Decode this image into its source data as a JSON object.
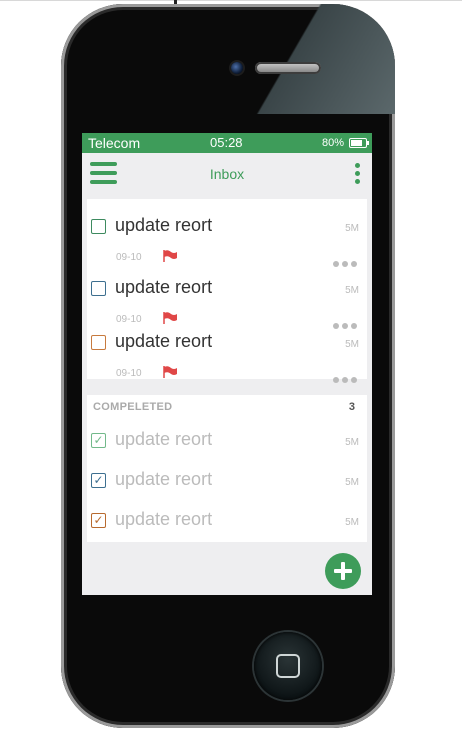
{
  "status_bar": {
    "carrier": "Telecom",
    "time": "05:28",
    "battery": "80%",
    "battery_level": 0.8
  },
  "header": {
    "title": "Inbox",
    "menu_icon": "hamburger-icon",
    "more_icon": "vertical-dots-icon"
  },
  "tasks": [
    {
      "title": "update reort",
      "size": "5M",
      "date": "09-10",
      "checkbox_color": "#3d8a5f",
      "flag_color": "#e04747"
    },
    {
      "title": "update reort",
      "size": "5M",
      "date": "09-10",
      "checkbox_color": "#3d6f8f",
      "flag_color": "#e04747"
    },
    {
      "title": "update reort",
      "size": "5M",
      "date": "09-10",
      "checkbox_color": "#c77a3e",
      "flag_color": "#e04747"
    }
  ],
  "completed": {
    "heading": "COMPELETED",
    "count": "3",
    "items": [
      {
        "title": "update reort",
        "size": "5M",
        "checkbox_color": "#72b98a",
        "check": "✓"
      },
      {
        "title": "update reort",
        "size": "5M",
        "checkbox_color": "#3d6f8f",
        "check": "✓"
      },
      {
        "title": "update reort",
        "size": "5M",
        "checkbox_color": "#b86a2e",
        "check": "✓"
      }
    ]
  },
  "fab": {
    "icon": "plus-icon",
    "color": "#3e9c5a"
  }
}
